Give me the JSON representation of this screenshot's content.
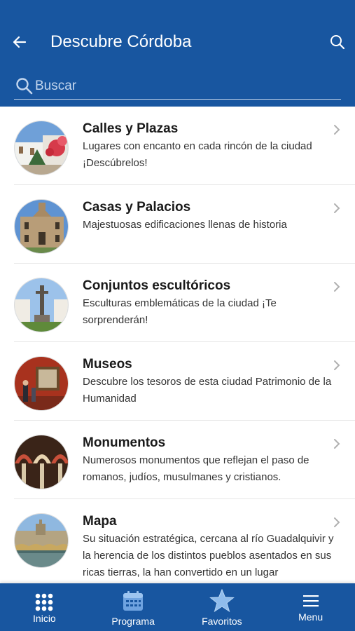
{
  "header": {
    "title": "Descubre Córdoba",
    "search_placeholder": "Buscar"
  },
  "items": [
    {
      "title": "Calles y Plazas",
      "description": " Lugares con encanto en cada rincón de la ciudad ¡Descúbrelos!",
      "image": "whitewashed-street-with-flowers"
    },
    {
      "title": "Casas y Palacios",
      "description": " Majestuosas edificaciones llenas de historia",
      "image": "palace-facade"
    },
    {
      "title": "Conjuntos escultóricos",
      "description": " Esculturas emblemáticas de la ciudad ¡Te sorprenderán!",
      "image": "sculpture-in-plaza"
    },
    {
      "title": "Museos",
      "description": " Descubre los tesoros de esta ciudad Patrimonio de la Humanidad",
      "image": "museum-interior"
    },
    {
      "title": "Monumentos",
      "description": " Numerosos monumentos que reflejan el paso de romanos, judíos, musulmanes y cristianos.",
      "image": "mosque-arches"
    },
    {
      "title": "Mapa",
      "description": " Su situación estratégica, cercana al río Guadalquivir y la herencia de los distintos pueblos asentados en sus ricas tierras, la han convertido en un lugar",
      "image": "city-river-panorama"
    }
  ],
  "tabs": [
    {
      "label": "Inicio",
      "icon": "grid-icon"
    },
    {
      "label": "Programa",
      "icon": "calendar-icon"
    },
    {
      "label": "Favoritos",
      "icon": "star-icon"
    },
    {
      "label": "Menu",
      "icon": "hamburger-icon"
    }
  ],
  "colors": {
    "brand": "#1856a0"
  }
}
